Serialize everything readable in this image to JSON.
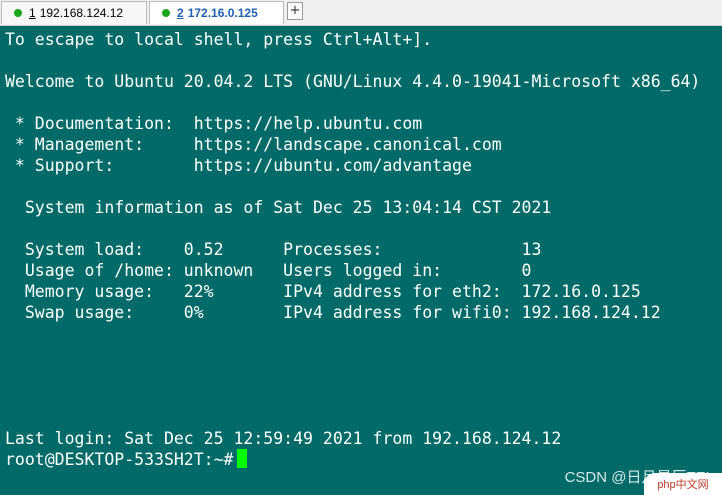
{
  "tabs": [
    {
      "number": "1",
      "label": "192.168.124.12",
      "status_color": "#1aa51a",
      "active": false
    },
    {
      "number": "2",
      "label": "172.16.0.125",
      "status_color": "#1aa51a",
      "active": true
    }
  ],
  "new_tab_label": "+",
  "terminal": {
    "background": "#006a69",
    "lines": [
      "To escape to local shell, press Ctrl+Alt+].",
      "",
      "Welcome to Ubuntu 20.04.2 LTS (GNU/Linux 4.4.0-19041-Microsoft x86_64)",
      "",
      " * Documentation:  https://help.ubuntu.com",
      " * Management:     https://landscape.canonical.com",
      " * Support:        https://ubuntu.com/advantage",
      "",
      "  System information as of Sat Dec 25 13:04:14 CST 2021",
      "",
      "  System load:    0.52      Processes:              13",
      "  Usage of /home: unknown   Users logged in:        0",
      "  Memory usage:   22%       IPv4 address for eth2:  172.16.0.125",
      "  Swap usage:     0%        IPv4 address for wifi0: 192.168.124.12",
      "",
      "",
      "",
      "",
      "",
      "",
      "Last login: Sat Dec 25 12:59:49 2021 from 192.168.124.12",
      "root@DESKTOP-533SH2T:~#"
    ],
    "cursor_color": "#00ff00"
  },
  "watermark": {
    "text": "CSDN @日月星辰TEL",
    "logo_text": "php中文网"
  }
}
